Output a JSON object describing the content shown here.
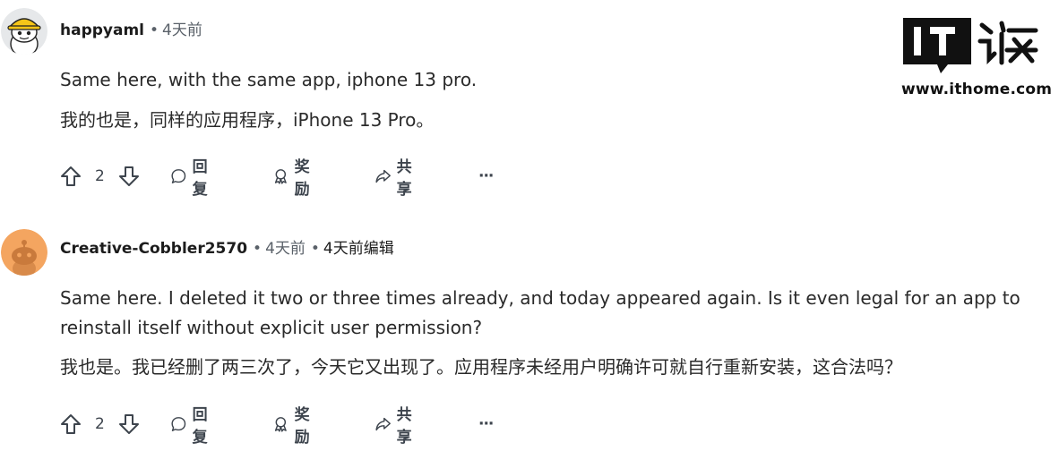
{
  "watermark": {
    "brand": "IT之家",
    "url": "www.ithome.com"
  },
  "comments": [
    {
      "username": "happyaml",
      "time": "4天前",
      "edited": "",
      "body_en": "Same here, with the same app, iphone 13 pro.",
      "body_zh": "我的也是，同样的应用程序，iPhone 13 Pro。",
      "votes": "2",
      "reply_label": "回复",
      "award_label": "奖励",
      "share_label": "共享",
      "more_label": "···",
      "avatar_icon": "yellow-hat-snoo-avatar-icon"
    },
    {
      "username": "Creative-Cobbler2570",
      "time": "4天前",
      "edited": "4天前编辑",
      "body_en": "Same here. I deleted it two or three times already, and today appeared again. Is it even legal for an app to reinstall itself without explicit user permission?",
      "body_zh": "我也是。我已经删了两三次了，今天它又出现了。应用程序未经用户明确许可就自行重新安装，这合法吗？",
      "votes": "2",
      "reply_label": "回复",
      "award_label": "奖励",
      "share_label": "共享",
      "more_label": "···",
      "avatar_icon": "orange-snoo-avatar-icon"
    }
  ],
  "colors": {
    "meta_gray": "#5a6169",
    "text": "#1c1c1c",
    "avatar_orange": "#f4a560"
  }
}
